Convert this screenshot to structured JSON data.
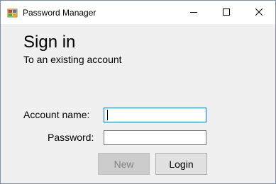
{
  "window": {
    "title": "Password Manager",
    "icon": "password-manager-app-icon",
    "controls": {
      "minimize_icon": "minimize-icon",
      "maximize_icon": "maximize-icon",
      "close_icon": "close-icon"
    }
  },
  "form": {
    "heading": "Sign in",
    "subheading": "To an existing account",
    "account_label": "Account name:",
    "account_value": "",
    "password_label": "Password:",
    "password_value": ""
  },
  "buttons": {
    "new_label": "New",
    "new_enabled": false,
    "login_label": "Login"
  },
  "colors": {
    "focus_border": "#0078d7",
    "window_background": "#f0f0f0",
    "disabled_button_background": "#cccccc",
    "button_background": "#e1e1e1"
  }
}
